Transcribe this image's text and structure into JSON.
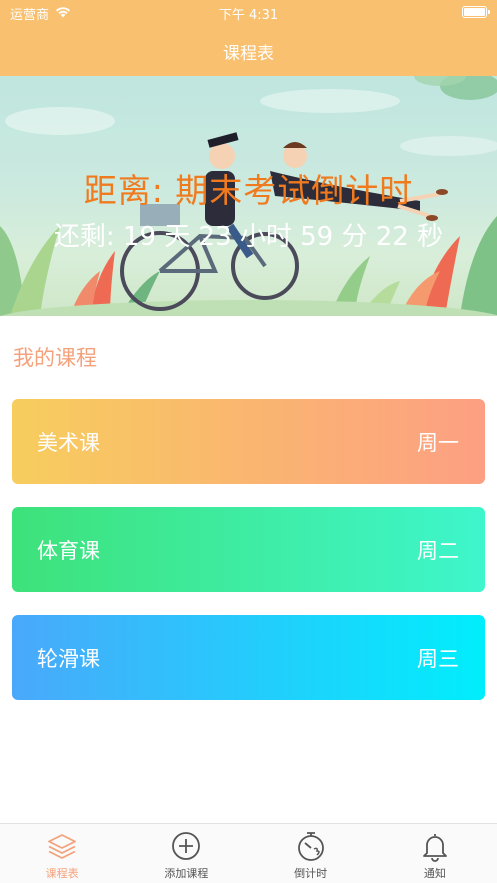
{
  "status_bar": {
    "carrier": "运营商",
    "time": "下午 4:31",
    "icons": [
      "wifi-icon",
      "battery-icon"
    ]
  },
  "nav": {
    "title": "课程表"
  },
  "banner": {
    "countdown_title": "距离: 期末考试倒计时",
    "countdown_remaining": "还剩: 19 天 23 小时 59 分 22 秒"
  },
  "section": {
    "title": "我的课程"
  },
  "courses": [
    {
      "name": "美术课",
      "day": "周一"
    },
    {
      "name": "体育课",
      "day": "周二"
    },
    {
      "name": "轮滑课",
      "day": "周三"
    }
  ],
  "tabs": [
    {
      "label": "课程表",
      "icon": "layers-icon",
      "active": true
    },
    {
      "label": "添加课程",
      "icon": "plus-circle-icon",
      "active": false
    },
    {
      "label": "倒计时",
      "icon": "stopwatch-icon",
      "active": false
    },
    {
      "label": "通知",
      "icon": "bell-icon",
      "active": false
    }
  ],
  "colors": {
    "accent": "#f9c06f",
    "section_title": "#f4a27c",
    "countdown_title": "#f07a1e"
  }
}
